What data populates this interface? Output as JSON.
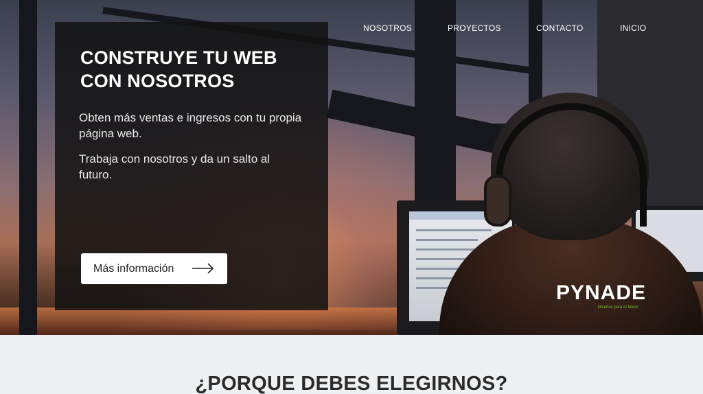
{
  "nav": {
    "items": [
      {
        "label": "NOSOTROS"
      },
      {
        "label": "PROYECTOS"
      },
      {
        "label": "CONTACTO"
      },
      {
        "label": "INICIO"
      }
    ]
  },
  "hero": {
    "title": "CONSTRUYE TU WEB CON NOSOTROS",
    "paragraph1": "Obten más ventas e ingresos con tu propia página web.",
    "paragraph2": "Trabaja con nosotros y da un salto al futuro.",
    "button_label": "Más información",
    "button_icon": "arrow-right-icon"
  },
  "logo": {
    "name": "PYNADE",
    "tagline": "Diseños para el futuro",
    "tagline_color": "#7fbf2a"
  },
  "section": {
    "title": "¿PORQUE DEBES ELEGIRNOS?"
  },
  "colors": {
    "card_background": "#121111",
    "page_background": "#eef0f2",
    "button_background": "#ffffff"
  }
}
